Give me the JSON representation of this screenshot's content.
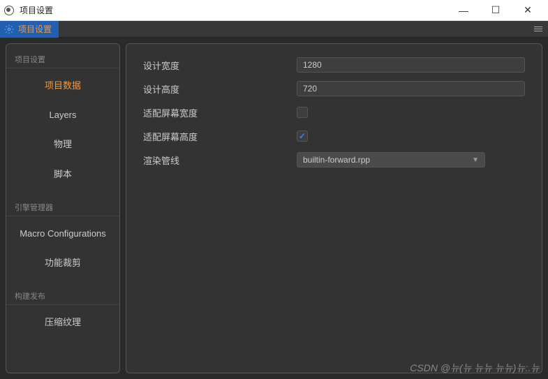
{
  "window": {
    "title": "项目设置"
  },
  "tab": {
    "label": "项目设置"
  },
  "sidebar": {
    "sections": [
      {
        "header": "项目设置",
        "items": [
          "项目数据",
          "Layers",
          "物理",
          "脚本"
        ]
      },
      {
        "header": "引擎管理器",
        "items": [
          "Macro Configurations",
          "功能裁剪"
        ]
      },
      {
        "header": "构建发布",
        "items": [
          "压缩纹理"
        ]
      }
    ],
    "active": "项目数据"
  },
  "form": {
    "designWidth": {
      "label": "设计宽度",
      "value": "1280"
    },
    "designHeight": {
      "label": "设计高度",
      "value": "720"
    },
    "fitWidth": {
      "label": "适配屏幕宽度",
      "checked": false
    },
    "fitHeight": {
      "label": "适配屏幕高度",
      "checked": true
    },
    "pipeline": {
      "label": "渲染管线",
      "value": "builtin-forward.rpp"
    }
  },
  "watermark": "CSDN @뉴(뉴 뉴뉴 뉴뉴)뉴:.뉴"
}
